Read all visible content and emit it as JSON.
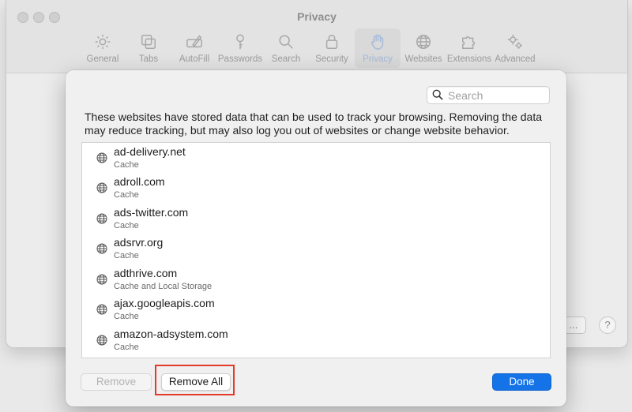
{
  "window": {
    "title": "Privacy",
    "toolbar": [
      {
        "label": "General",
        "icon": "gear-icon"
      },
      {
        "label": "Tabs",
        "icon": "tabs-icon"
      },
      {
        "label": "AutoFill",
        "icon": "pencil-icon"
      },
      {
        "label": "Passwords",
        "icon": "key-icon"
      },
      {
        "label": "Search",
        "icon": "magnifier-icon"
      },
      {
        "label": "Security",
        "icon": "lock-icon"
      },
      {
        "label": "Privacy",
        "icon": "hand-icon"
      },
      {
        "label": "Websites",
        "icon": "globe-icon"
      },
      {
        "label": "Extensions",
        "icon": "puzzle-icon"
      },
      {
        "label": "Advanced",
        "icon": "gears-icon"
      }
    ],
    "active_tab": "Privacy",
    "details_button_label": "...",
    "help_button_label": "?"
  },
  "sheet": {
    "search": {
      "placeholder": "Search",
      "value": ""
    },
    "description": "These websites have stored data that can be used to track your browsing. Removing the data may reduce tracking, but may also log you out of websites or change website behavior.",
    "websites": [
      {
        "domain": "ad-delivery.net",
        "data": "Cache"
      },
      {
        "domain": "adroll.com",
        "data": "Cache"
      },
      {
        "domain": "ads-twitter.com",
        "data": "Cache"
      },
      {
        "domain": "adsrvr.org",
        "data": "Cache"
      },
      {
        "domain": "adthrive.com",
        "data": "Cache and Local Storage"
      },
      {
        "domain": "ajax.googleapis.com",
        "data": "Cache"
      },
      {
        "domain": "amazon-adsystem.com",
        "data": "Cache"
      }
    ],
    "buttons": {
      "remove": "Remove",
      "remove_all": "Remove All",
      "done": "Done"
    }
  },
  "colors": {
    "accent": "#1473e6",
    "highlight": "#e23a2b"
  }
}
